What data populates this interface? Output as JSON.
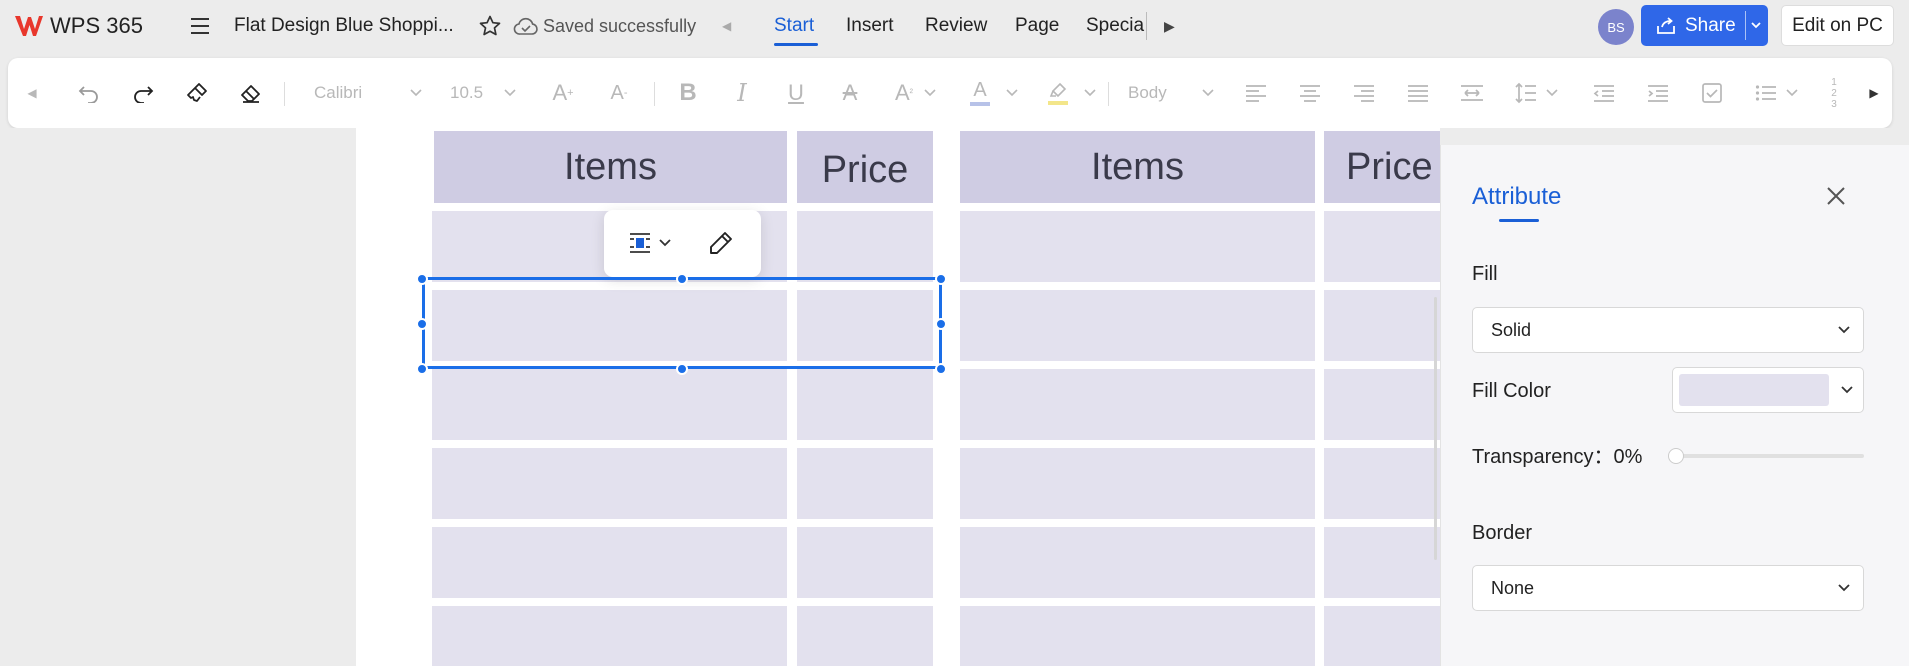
{
  "app": {
    "name": "WPS 365",
    "brand_color": "#e8372c"
  },
  "document": {
    "title": "Flat Design Blue Shoppi...",
    "status": "Saved successfully"
  },
  "tabs": [
    {
      "label": "Start",
      "active": true
    },
    {
      "label": "Insert",
      "active": false
    },
    {
      "label": "Review",
      "active": false
    },
    {
      "label": "Page",
      "active": false
    },
    {
      "label": "Specia",
      "active": false
    }
  ],
  "user": {
    "initials": "BS",
    "avatar_color": "#7b83cc"
  },
  "share": {
    "label": "Share",
    "color": "#2f67e8"
  },
  "edit_pc": {
    "label": "Edit on PC"
  },
  "toolbar": {
    "font_name": "Calibri",
    "font_size": "10.5",
    "style": "Body",
    "icons": [
      "undo-icon",
      "redo-icon",
      "format-painter-icon",
      "eraser-icon",
      "increase-font-icon",
      "decrease-font-icon",
      "bold-icon",
      "italic-icon",
      "underline-icon",
      "strikethrough-icon",
      "superscript-icon",
      "font-color-icon",
      "highlight-icon",
      "align-left-icon",
      "align-center-icon",
      "align-right-icon",
      "justify-icon",
      "distributed-icon",
      "line-spacing-icon",
      "decrease-indent-icon",
      "increase-indent-icon",
      "checkbox-icon",
      "bullet-list-icon",
      "numbered-list-icon"
    ]
  },
  "table": {
    "header_color": "#cfcce3",
    "cell_color": "#e3e1ee",
    "headers": [
      "Items",
      "Price",
      "Items",
      "Price"
    ]
  },
  "panel": {
    "title": "Attribute",
    "fill_label": "Fill",
    "fill_value": "Solid",
    "fill_color_label": "Fill Color",
    "fill_color": "#e3e1ee",
    "transparency_label": "Transparency：",
    "transparency_value": "0%",
    "transparency_fraction": 0,
    "border_label": "Border",
    "border_value": "None"
  },
  "accent_color": "#1a5fd6"
}
